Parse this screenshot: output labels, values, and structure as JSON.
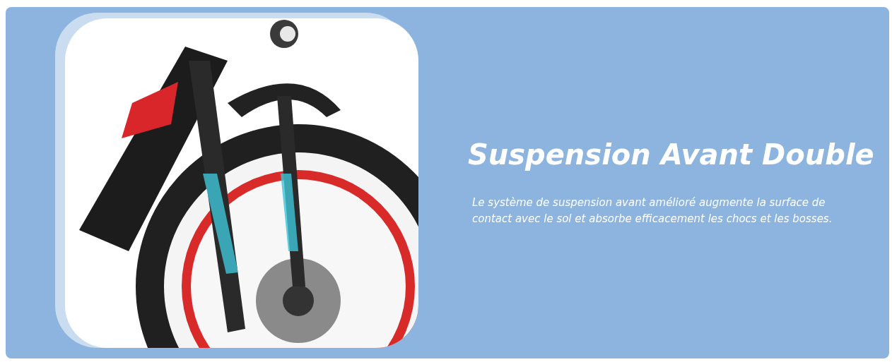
{
  "feature": {
    "title": "Suspension Avant Double",
    "description": "Le système de suspension avant amélioré augmente la surface de contact avec le sol et absorbe efficacement les chocs et les bosses."
  }
}
